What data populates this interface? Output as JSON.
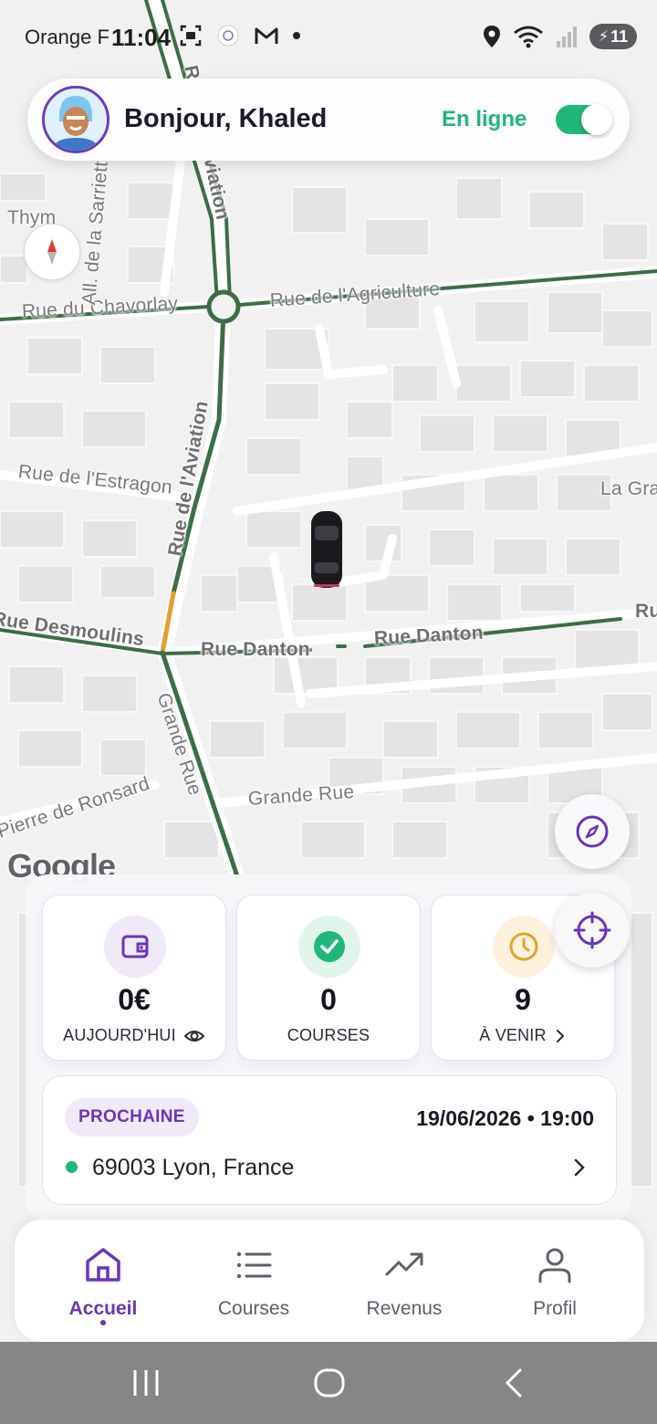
{
  "status_bar": {
    "carrier": "Orange F",
    "time": "11:04",
    "battery_level": "11",
    "icons_left": [
      "screenshot-icon",
      "only-app-icon",
      "gmail-icon",
      "dot-icon"
    ],
    "icons_right": [
      "location-icon",
      "wifi-icon",
      "signal-icon",
      "battery-icon"
    ]
  },
  "header": {
    "greeting": "Bonjour, Khaled",
    "status_label": "En ligne",
    "online": true
  },
  "map": {
    "roads": [
      {
        "label": "Rue de l'Aviation"
      },
      {
        "label": "Rue du Chavorlay"
      },
      {
        "label": "Rue de l'Agriculture"
      },
      {
        "label": "Rue de l'Estragon"
      },
      {
        "label": "Rue Desmoulins"
      },
      {
        "label": "Rue Danton"
      },
      {
        "label": "Rue Danton"
      },
      {
        "label": "Grande Rue"
      },
      {
        "label": "Grande Rue"
      },
      {
        "label": "Pierre de Ronsard"
      },
      {
        "label": "All. de la Sarriette"
      },
      {
        "label": "Thym"
      },
      {
        "label": "La Gra"
      },
      {
        "label": "Ru"
      }
    ],
    "attribution": "Google"
  },
  "stats": [
    {
      "value": "0€",
      "label": "AUJOURD'HUI",
      "icon": "wallet-icon",
      "extra_icon": "eye-icon"
    },
    {
      "value": "0",
      "label": "COURSES",
      "icon": "check-circle-icon"
    },
    {
      "value": "9",
      "label": "À VENIR",
      "icon": "clock-icon",
      "extra_icon": "chevron-right-icon"
    }
  ],
  "next_ride": {
    "badge": "PROCHAINE",
    "datetime": "19/06/2026 • 19:00",
    "address": "69003 Lyon, France"
  },
  "nav": {
    "items": [
      {
        "label": "Accueil",
        "icon": "home-icon",
        "active": true
      },
      {
        "label": "Courses",
        "icon": "list-icon",
        "active": false
      },
      {
        "label": "Revenus",
        "icon": "trending-up-icon",
        "active": false
      },
      {
        "label": "Profil",
        "icon": "user-icon",
        "active": false
      }
    ]
  },
  "colors": {
    "accent": "#6b35b8",
    "online_green": "#1fb77a",
    "route_green": "#2f6b3f"
  }
}
